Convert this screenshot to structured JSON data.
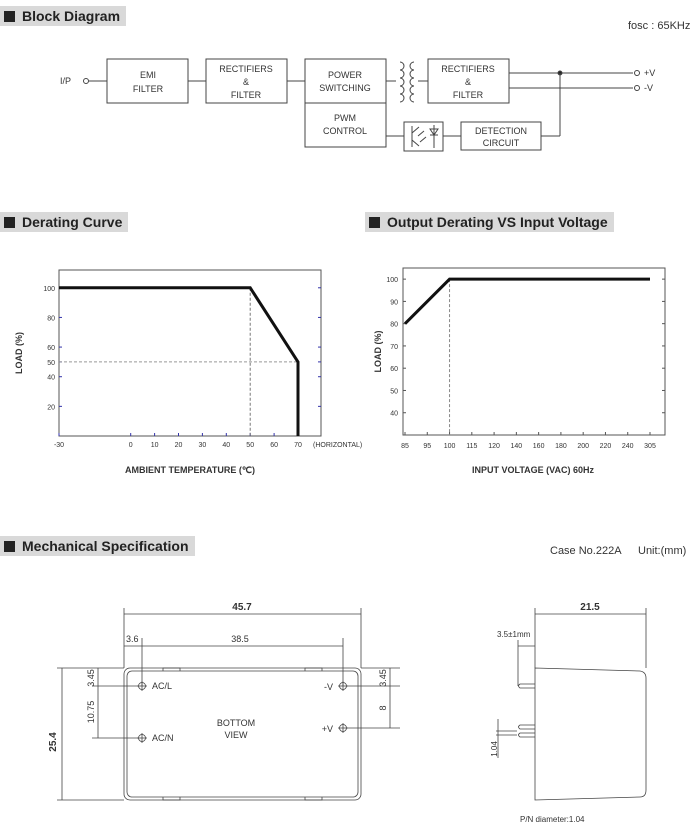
{
  "sections": {
    "block_diagram": "Block Diagram",
    "derating_curve": "Derating Curve",
    "output_derating": "Output Derating VS Input Voltage",
    "mechanical": "Mechanical Specification"
  },
  "block_diagram": {
    "fosc": "fosc : 65KHz",
    "input_label": "I/P",
    "blocks": {
      "emi": [
        "EMI",
        "FILTER"
      ],
      "rect1": [
        "RECTIFIERS",
        "&",
        "FILTER"
      ],
      "power": [
        "POWER",
        "SWITCHING"
      ],
      "pwm": [
        "PWM",
        "CONTROL"
      ],
      "rect2": [
        "RECTIFIERS",
        "&",
        "FILTER"
      ],
      "detect": [
        "DETECTION",
        "CIRCUIT"
      ]
    },
    "outputs": [
      "+V",
      "-V"
    ]
  },
  "chart_data": [
    {
      "type": "line",
      "title": "Derating Curve",
      "xlabel": "AMBIENT TEMPERATURE (℃)",
      "ylabel": "LOAD (%)",
      "x_suffix_label": "(HORIZONTAL)",
      "xlim": [
        -30,
        80
      ],
      "ylim": [
        0,
        112
      ],
      "x_ticks": [
        -30,
        0,
        10,
        20,
        30,
        40,
        50,
        60,
        70
      ],
      "y_ticks": [
        20,
        40,
        50,
        60,
        80,
        100
      ],
      "series": [
        {
          "name": "load",
          "x": [
            -30,
            50,
            70,
            70
          ],
          "y": [
            100,
            100,
            50,
            0
          ]
        }
      ],
      "guides": [
        {
          "x": 50,
          "y": 100
        },
        {
          "x": 70,
          "y": 50
        }
      ],
      "grid": false
    },
    {
      "type": "line",
      "title": "Output Derating VS Input Voltage",
      "xlabel": "INPUT VOLTAGE (VAC) 60Hz",
      "ylabel": "LOAD (%)",
      "x_ticks": [
        "85",
        "95",
        "100",
        "115",
        "120",
        "140",
        "160",
        "180",
        "200",
        "220",
        "240",
        "305"
      ],
      "ylim": [
        30,
        105
      ],
      "y_ticks": [
        40,
        50,
        60,
        70,
        80,
        90,
        100
      ],
      "series": [
        {
          "name": "load",
          "x": [
            "85",
            "100",
            "305"
          ],
          "y": [
            80,
            100,
            100
          ]
        }
      ],
      "guides": [
        {
          "x": "100",
          "y": 100
        }
      ],
      "grid": false
    }
  ],
  "mechanical": {
    "case_no": "Case No.222A",
    "unit": "Unit:(mm)",
    "bottom_view": [
      "BOTTOM",
      "VIEW"
    ],
    "pins": [
      "AC/L",
      "AC/N",
      "-V",
      "+V"
    ],
    "dims": {
      "width": "45.7",
      "pin_offset": "3.6",
      "pin_span": "38.5",
      "height": "25.4",
      "top_left": "3.45",
      "left_pitch": "10.75",
      "top_right": "3.45",
      "right_pitch": "8",
      "side_depth": "21.5",
      "pin_length": "3.5±1mm",
      "pin_dia": "1.04"
    },
    "pn_diameter": "P/N diameter:1.04"
  }
}
